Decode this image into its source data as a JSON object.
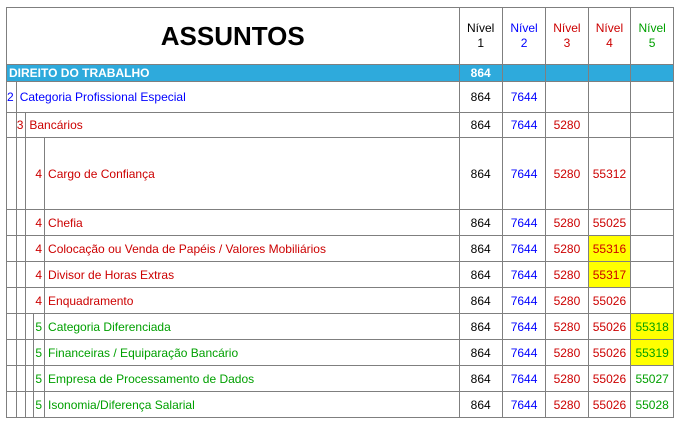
{
  "header": {
    "title": "ASSUNTOS",
    "levels": [
      {
        "word": "Nível",
        "num": "1"
      },
      {
        "word": "Nível",
        "num": "2"
      },
      {
        "word": "Nível",
        "num": "3"
      },
      {
        "word": "Nível",
        "num": "4"
      },
      {
        "word": "Nível",
        "num": "5"
      }
    ]
  },
  "colors": {
    "level1": "#000000",
    "level2": "#0000ff",
    "level3": "#cc0000",
    "level4": "#cc0000",
    "level5": "#00a000",
    "section_bar": "#2eaadc",
    "highlight": "#ffff00"
  },
  "section": {
    "label": "DIREITO DO TRABALHO",
    "n1": "864"
  },
  "rows": [
    {
      "ind": "2",
      "label": "Categoria Profissional Especial",
      "n1": "864",
      "n2": "7644",
      "n3": "",
      "n4": "",
      "n5": ""
    },
    {
      "ind": "3",
      "label": "Bancários",
      "n1": "864",
      "n2": "7644",
      "n3": "5280",
      "n4": "",
      "n5": ""
    },
    {
      "ind": "4",
      "label": "Cargo de Confiança",
      "n1": "864",
      "n2": "7644",
      "n3": "5280",
      "n4": "55312",
      "n5": ""
    },
    {
      "ind": "4",
      "label": "Chefia",
      "n1": "864",
      "n2": "7644",
      "n3": "5280",
      "n4": "55025",
      "n5": ""
    },
    {
      "ind": "4",
      "label": "Colocação ou Venda de Papéis / Valores Mobiliários",
      "n1": "864",
      "n2": "7644",
      "n3": "5280",
      "n4": "55316",
      "n5": ""
    },
    {
      "ind": "4",
      "label": "Divisor de Horas Extras",
      "n1": "864",
      "n2": "7644",
      "n3": "5280",
      "n4": "55317",
      "n5": ""
    },
    {
      "ind": "4",
      "label": "Enquadramento",
      "n1": "864",
      "n2": "7644",
      "n3": "5280",
      "n4": "55026",
      "n5": ""
    },
    {
      "ind": "5",
      "label": "Categoria Diferenciada",
      "n1": "864",
      "n2": "7644",
      "n3": "5280",
      "n4": "55026",
      "n5": "55318"
    },
    {
      "ind": "5",
      "label": "Financeiras / Equiparação Bancário",
      "n1": "864",
      "n2": "7644",
      "n3": "5280",
      "n4": "55026",
      "n5": "55319"
    },
    {
      "ind": "5",
      "label": "Empresa de Processamento de Dados",
      "n1": "864",
      "n2": "7644",
      "n3": "5280",
      "n4": "55026",
      "n5": "55027"
    },
    {
      "ind": "5",
      "label": "Isonomia/Diferença Salarial",
      "n1": "864",
      "n2": "7644",
      "n3": "5280",
      "n4": "55026",
      "n5": "55028"
    }
  ]
}
